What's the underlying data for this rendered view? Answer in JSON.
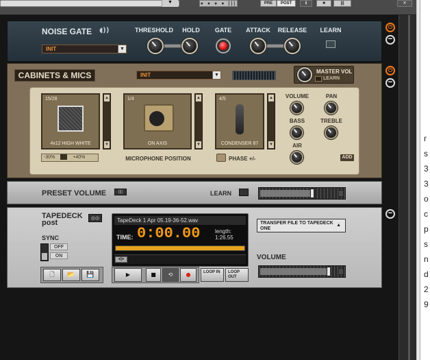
{
  "topbar": {
    "pre_label": "PRE",
    "post_label": "POST",
    "dots": "● ● ● ● |||",
    "info_icon": "info-icon",
    "cup_icon": "cup-icon",
    "meter_icon": "meter-icon"
  },
  "noise_gate": {
    "title": "NOISE GATE",
    "preset": "INIT",
    "labels": {
      "threshold": "THRESHOLD",
      "hold": "HOLD",
      "gate": "GATE",
      "attack": "ATTACK",
      "release": "RELEASE",
      "learn": "LEARN"
    },
    "accent_color": "#e9933a"
  },
  "cabinets": {
    "title": "CABINETS & MICS",
    "preset": "INIT",
    "master_vol_label": "MASTER VOL",
    "master_learn_label": "LEARN",
    "cabinet": {
      "count": "15/28",
      "name": "4x12 HIGH WHITE"
    },
    "mic_position": {
      "count": "1/4",
      "name": "ON AXIS",
      "label": "MICROPHONE POSITION"
    },
    "mic": {
      "count": "4/5",
      "name": "CONDENSER 87"
    },
    "position_range": {
      "left": "-30%",
      "right": "+40%"
    },
    "phase_label": "PHASE +/-",
    "knobs": {
      "volume": "VOLUME",
      "pan": "PAN",
      "bass": "BASS",
      "treble": "TREBLE",
      "air": "AIR"
    },
    "add_label": "ADD"
  },
  "preset_volume": {
    "title": "PRESET VOLUME",
    "learn_label": "LEARN",
    "level": 0.68
  },
  "tapedeck": {
    "title_line1": "TAPEDECK",
    "title_line2": "post",
    "sync_label": "SYNC",
    "sync_off": "OFF",
    "sync_on": "ON",
    "file_name": "TapeDeck 1  Apr 05.19-36-52.wav",
    "time_label": "TIME:",
    "time_value": "0:00.00",
    "length_label": "length:",
    "length_value": "1:26.55",
    "transfer_label": "TRANSFER FILE TO TAPEDECK ONE",
    "volume_label": "VOLUME",
    "loop_in_label": "LOOP IN",
    "loop_out_label": "LOOP OUT",
    "volume_level": 0.9,
    "progress": 1.0
  },
  "right_pane_chars": [
    "r",
    "s",
    "3",
    "3",
    "o",
    "c",
    "p",
    "s",
    "n",
    "d",
    "2",
    "9"
  ]
}
